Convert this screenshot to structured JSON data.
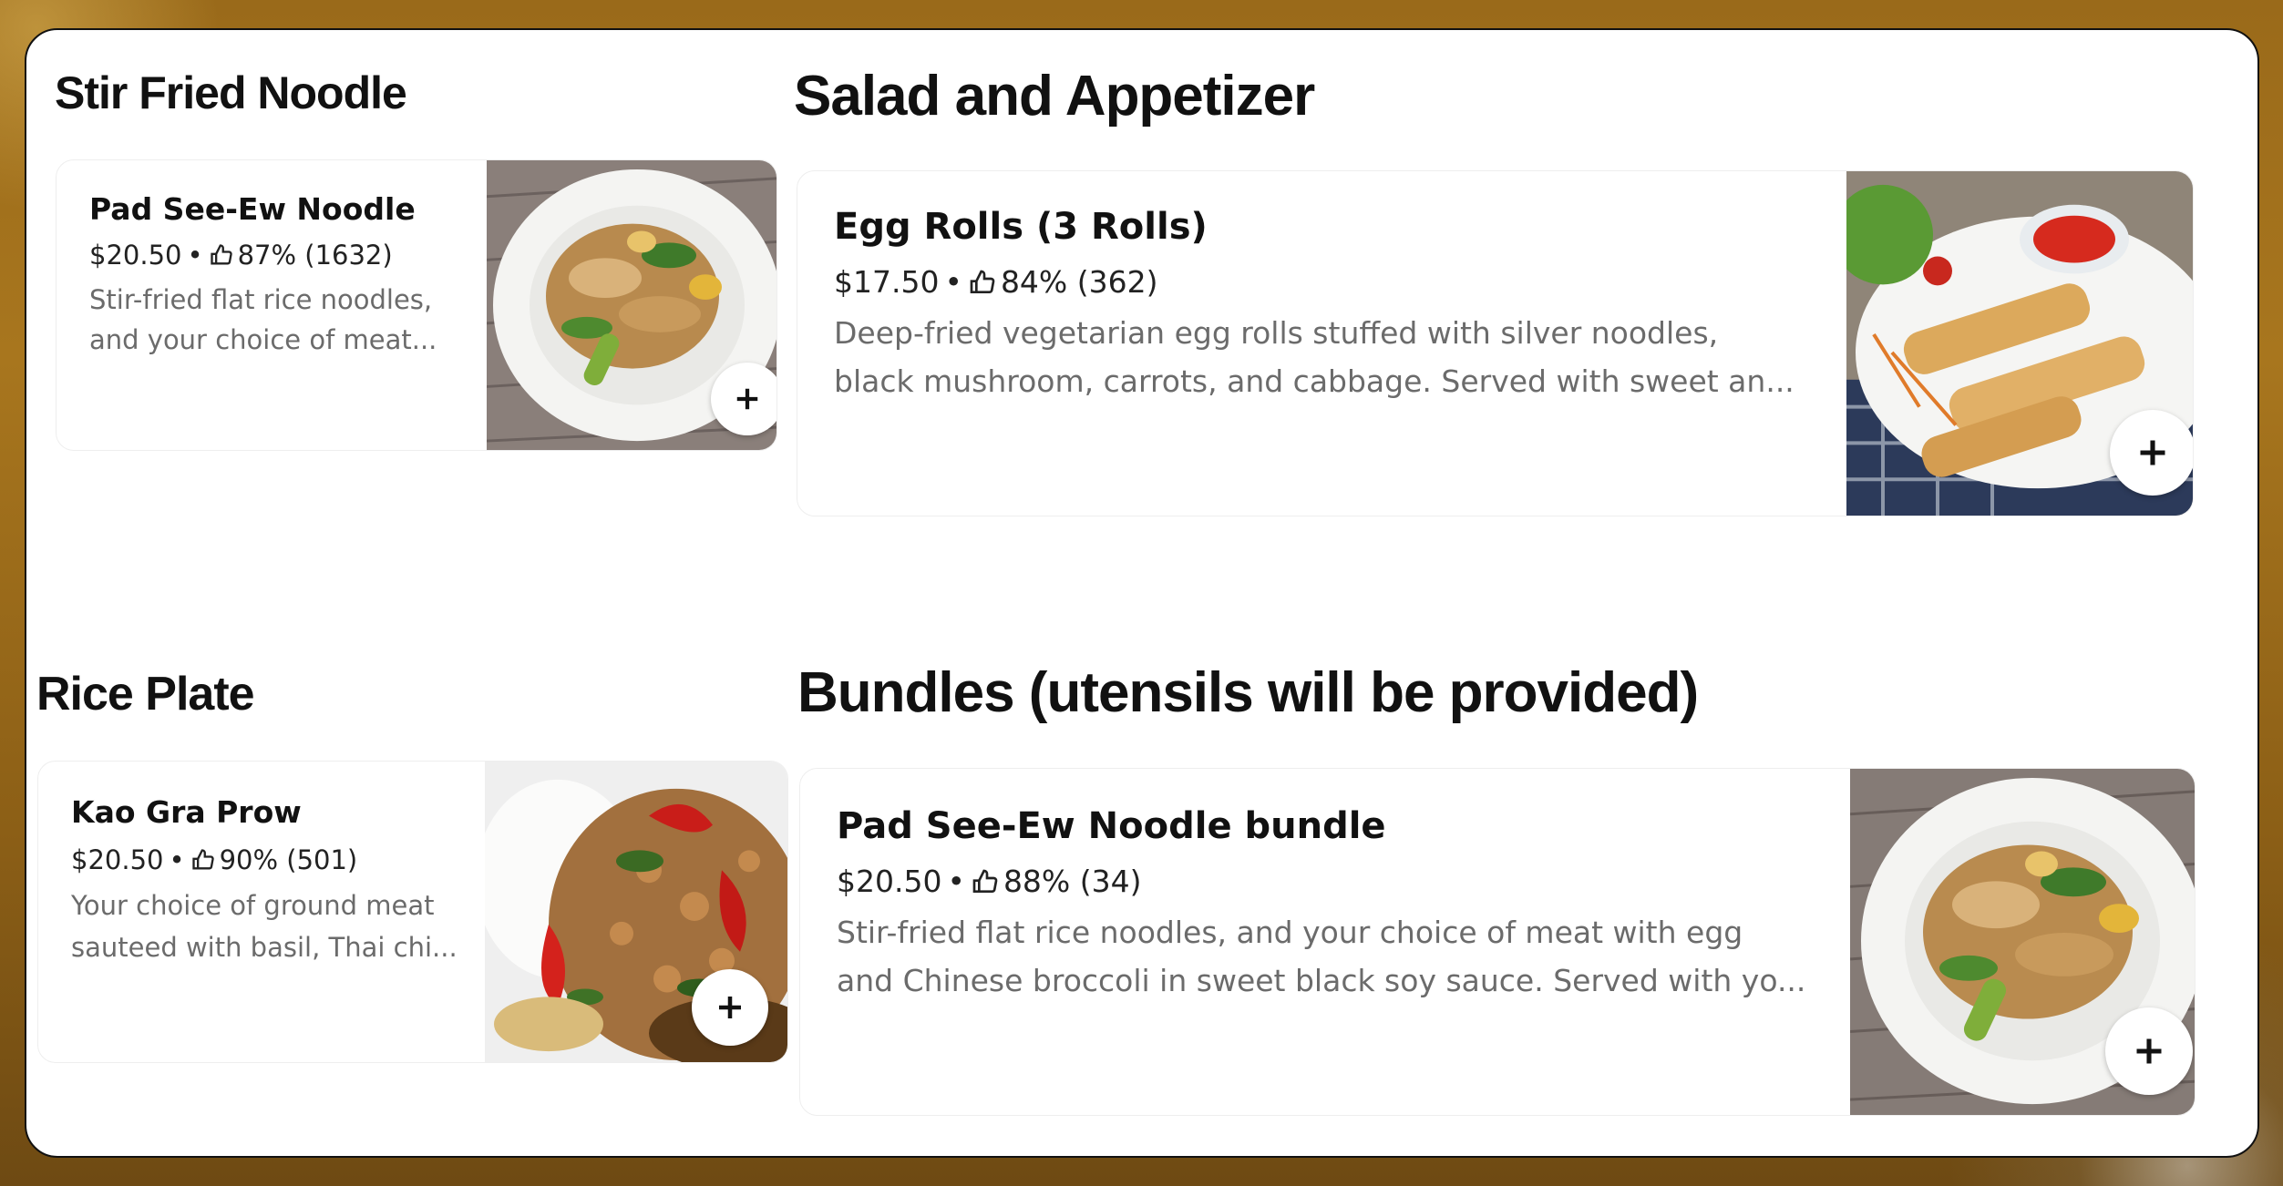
{
  "sections": {
    "stir_fried": {
      "title": "Stir Fried Noodle",
      "item": {
        "name": "Pad See-Ew Noodle",
        "price": "$20.50",
        "rating": "87% (1632)",
        "desc_line1": "Stir-fried flat rice noodles,",
        "desc_line2": "and your choice of meat..."
      }
    },
    "salad": {
      "title": "Salad and Appetizer",
      "item": {
        "name": "Egg Rolls (3 Rolls)",
        "price": "$17.50",
        "rating": "84% (362)",
        "desc_line1": "Deep-fried vegetarian egg rolls stuffed with silver noodles,",
        "desc_line2": "black mushroom, carrots, and cabbage. Served with sweet an..."
      }
    },
    "rice": {
      "title": "Rice Plate",
      "item": {
        "name": "Kao Gra Prow",
        "price": "$20.50",
        "rating": "90% (501)",
        "desc_line1": "Your choice of ground meat",
        "desc_line2": "sauteed with basil, Thai chi..."
      }
    },
    "bundles": {
      "title": "Bundles (utensils will be provided)",
      "item": {
        "name": "Pad See-Ew Noodle bundle",
        "price": "$20.50",
        "rating": "88% (34)",
        "desc_line1": "Stir-fried flat rice noodles, and your choice of meat with egg",
        "desc_line2": "and Chinese broccoli in sweet black soy sauce. Served with yo..."
      }
    }
  },
  "separator": "•",
  "icons": {
    "rating": "thumbs-up-icon",
    "add": "plus-icon"
  }
}
